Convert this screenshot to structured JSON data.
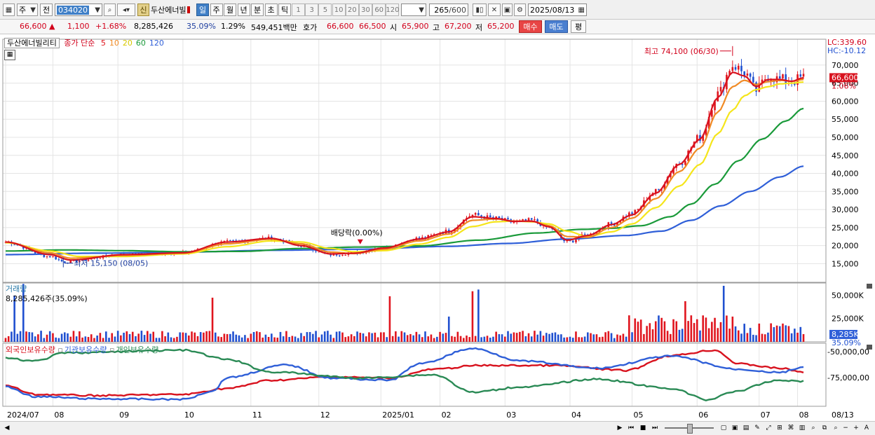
{
  "toolbar": {
    "period_label": "주",
    "prev_label": "전",
    "code_value": "034020",
    "stock_name": "두산에너빌",
    "new_badge": "신",
    "timeframes": [
      {
        "label": "일",
        "selected": true
      },
      {
        "label": "주",
        "selected": false
      },
      {
        "label": "월",
        "selected": false
      },
      {
        "label": "년",
        "selected": false
      },
      {
        "label": "분",
        "selected": false
      },
      {
        "label": "초",
        "selected": false
      },
      {
        "label": "틱",
        "selected": false
      }
    ],
    "intervals": [
      "1",
      "3",
      "5",
      "10",
      "20",
      "30",
      "60",
      "120"
    ],
    "count_value": "265",
    "count_total": "/600",
    "date_value": "2025/08/13"
  },
  "quote": {
    "price": "66,600",
    "arrow": "▲",
    "change": "1,100",
    "change_pct": "+1.68%",
    "volume": "8,285,426",
    "vol_ratio": "35.09%",
    "turnover": "1.29%",
    "amount": "549,451백만",
    "bid_label": "호가",
    "ask": "66,600",
    "bid": "66,500",
    "open_label": "시",
    "open": "65,900",
    "high_label": "고",
    "high": "67,200",
    "low_label": "저",
    "low": "65,200",
    "buy_label": "매수",
    "sell_label": "매도",
    "eval_label": "평"
  },
  "price_panel": {
    "name": "두산에너빌리티",
    "ma_title": "종가 단순",
    "ma_periods": [
      {
        "label": "5",
        "color": "#e0151e"
      },
      {
        "label": "10",
        "color": "#f08a24"
      },
      {
        "label": "20",
        "color": "#f0e01a"
      },
      {
        "label": "60",
        "color": "#1a9a3a"
      },
      {
        "label": "120",
        "color": "#2f5fd8"
      }
    ],
    "lc_label": "LC:339.60",
    "hc_label": "HC:-10.12",
    "current_tag": "66,600",
    "current_pct": "1.06%",
    "high_annotation": "최고 74,100 (06/30)",
    "low_annotation": "최저 15,150 (08/05)",
    "dividend_annotation": "배당락(0.00%)"
  },
  "volume_panel": {
    "title": "거래량",
    "value_text": "8,285,426주(35.09%)",
    "current_tag": "8,285K",
    "current_pct": "35.09%"
  },
  "holdings_panel": {
    "series": [
      {
        "label": "외국인보유수량",
        "color": "#d8121e"
      },
      {
        "label": "기관보유수량",
        "color": "#2f5fd8"
      },
      {
        "label": "개인보유수량",
        "color": "#2a8a55"
      }
    ]
  },
  "chart_data": [
    {
      "type": "line",
      "panel": "price",
      "y_ticks": [
        15000,
        20000,
        25000,
        30000,
        35000,
        40000,
        45000,
        50000,
        55000,
        60000,
        65000,
        70000
      ],
      "y_tick_labels": [
        "15,000",
        "20,000",
        "25,000",
        "30,000",
        "35,000",
        "40,000",
        "45,000",
        "50,000",
        "55,000",
        "60,000",
        "65,000",
        "70,000"
      ],
      "ylim": [
        11000,
        76000
      ],
      "x_labels": [
        "2024/07",
        "08",
        "09",
        "10",
        "11",
        "12",
        "2025/01",
        "02",
        "03",
        "04",
        "05",
        "06",
        "07",
        "08",
        "08/13"
      ],
      "close_anchors": [
        [
          0,
          21000
        ],
        [
          15,
          17000
        ],
        [
          20,
          15500
        ],
        [
          40,
          17500
        ],
        [
          60,
          18000
        ],
        [
          75,
          21000
        ],
        [
          90,
          22000
        ],
        [
          100,
          20000
        ],
        [
          110,
          17500
        ],
        [
          118,
          18000
        ],
        [
          128,
          19500
        ],
        [
          140,
          22000
        ],
        [
          150,
          24000
        ],
        [
          158,
          28500
        ],
        [
          166,
          27500
        ],
        [
          172,
          26500
        ],
        [
          178,
          27000
        ],
        [
          184,
          25000
        ],
        [
          190,
          21000
        ],
        [
          197,
          23000
        ],
        [
          205,
          26000
        ],
        [
          212,
          29000
        ],
        [
          220,
          35000
        ],
        [
          228,
          43000
        ],
        [
          235,
          50000
        ],
        [
          241,
          62000
        ],
        [
          246,
          70000
        ],
        [
          250,
          68000
        ],
        [
          254,
          63000
        ],
        [
          258,
          67000
        ],
        [
          262,
          66000
        ],
        [
          266,
          65500
        ],
        [
          270,
          66600
        ]
      ],
      "ma_anchors": {
        "ma5": [
          [
            0,
            21000
          ],
          [
            15,
            17500
          ],
          [
            22,
            16000
          ],
          [
            40,
            17500
          ],
          [
            60,
            18000
          ],
          [
            75,
            21000
          ],
          [
            90,
            22000
          ],
          [
            100,
            20000
          ],
          [
            110,
            17700
          ],
          [
            118,
            17900
          ],
          [
            128,
            19300
          ],
          [
            140,
            21800
          ],
          [
            150,
            23800
          ],
          [
            158,
            28000
          ],
          [
            166,
            27500
          ],
          [
            172,
            26700
          ],
          [
            178,
            26800
          ],
          [
            184,
            25200
          ],
          [
            190,
            21500
          ],
          [
            197,
            22800
          ],
          [
            205,
            25800
          ],
          [
            212,
            28500
          ],
          [
            220,
            34500
          ],
          [
            228,
            42500
          ],
          [
            235,
            49500
          ],
          [
            241,
            61000
          ],
          [
            246,
            68000
          ],
          [
            250,
            67000
          ],
          [
            254,
            64000
          ],
          [
            258,
            66000
          ],
          [
            262,
            66000
          ],
          [
            266,
            65500
          ],
          [
            270,
            66500
          ]
        ],
        "ma10": [
          [
            0,
            21000
          ],
          [
            15,
            18000
          ],
          [
            22,
            16500
          ],
          [
            40,
            17300
          ],
          [
            60,
            17900
          ],
          [
            75,
            20500
          ],
          [
            90,
            21800
          ],
          [
            100,
            20500
          ],
          [
            110,
            18200
          ],
          [
            118,
            17800
          ],
          [
            128,
            19000
          ],
          [
            140,
            21300
          ],
          [
            150,
            23200
          ],
          [
            158,
            27000
          ],
          [
            166,
            27400
          ],
          [
            172,
            26800
          ],
          [
            178,
            26700
          ],
          [
            184,
            25500
          ],
          [
            190,
            22500
          ],
          [
            197,
            22300
          ],
          [
            205,
            25000
          ],
          [
            212,
            27600
          ],
          [
            220,
            33000
          ],
          [
            228,
            40500
          ],
          [
            235,
            47000
          ],
          [
            241,
            57000
          ],
          [
            246,
            64000
          ],
          [
            250,
            65800
          ],
          [
            254,
            64600
          ],
          [
            258,
            65400
          ],
          [
            262,
            65800
          ],
          [
            266,
            65500
          ],
          [
            270,
            66000
          ]
        ],
        "ma20": [
          [
            0,
            20800
          ],
          [
            15,
            18500
          ],
          [
            25,
            17000
          ],
          [
            40,
            17000
          ],
          [
            60,
            17700
          ],
          [
            75,
            19700
          ],
          [
            90,
            21300
          ],
          [
            100,
            21000
          ],
          [
            110,
            19200
          ],
          [
            118,
            18300
          ],
          [
            128,
            18600
          ],
          [
            140,
            20400
          ],
          [
            150,
            22300
          ],
          [
            158,
            25300
          ],
          [
            166,
            26600
          ],
          [
            172,
            26800
          ],
          [
            178,
            26600
          ],
          [
            184,
            26000
          ],
          [
            190,
            24000
          ],
          [
            197,
            22500
          ],
          [
            205,
            23800
          ],
          [
            212,
            26000
          ],
          [
            220,
            30500
          ],
          [
            228,
            36500
          ],
          [
            235,
            42500
          ],
          [
            241,
            51000
          ],
          [
            246,
            57500
          ],
          [
            250,
            61500
          ],
          [
            254,
            63200
          ],
          [
            258,
            64000
          ],
          [
            262,
            64800
          ],
          [
            266,
            65000
          ],
          [
            270,
            65300
          ]
        ],
        "ma60": [
          [
            0,
            18500
          ],
          [
            20,
            18800
          ],
          [
            40,
            18600
          ],
          [
            60,
            18300
          ],
          [
            80,
            18400
          ],
          [
            100,
            19200
          ],
          [
            120,
            19600
          ],
          [
            140,
            19900
          ],
          [
            160,
            21500
          ],
          [
            180,
            23500
          ],
          [
            195,
            24500
          ],
          [
            205,
            24800
          ],
          [
            215,
            25500
          ],
          [
            225,
            28000
          ],
          [
            232,
            31500
          ],
          [
            240,
            37000
          ],
          [
            248,
            43500
          ],
          [
            256,
            49500
          ],
          [
            264,
            54500
          ],
          [
            270,
            58000
          ]
        ],
        "ma120": [
          [
            0,
            17500
          ],
          [
            30,
            17900
          ],
          [
            60,
            18200
          ],
          [
            90,
            18700
          ],
          [
            120,
            19000
          ],
          [
            150,
            19800
          ],
          [
            170,
            20600
          ],
          [
            190,
            21800
          ],
          [
            210,
            22800
          ],
          [
            222,
            24000
          ],
          [
            232,
            27000
          ],
          [
            242,
            31000
          ],
          [
            252,
            35000
          ],
          [
            262,
            39000
          ],
          [
            270,
            42000
          ]
        ]
      },
      "annotations": [
        {
          "text": "최고 74,100 (06/30)",
          "x_index": 246,
          "value": 74100
        },
        {
          "text": "최저 15,150 (08/05)",
          "x_index": 20,
          "value": 15150
        },
        {
          "text": "배당락(0.00%)",
          "x_index": 120,
          "value": 19000
        }
      ]
    },
    {
      "type": "bar",
      "panel": "volume",
      "y_tick_labels": [
        "25,000K",
        "50,000K"
      ],
      "y_ticks": [
        25000,
        50000
      ],
      "ylim": [
        0,
        60000
      ],
      "unit": "K shares",
      "current_value": 8285
    },
    {
      "type": "line",
      "panel": "holdings",
      "y_tick_labels": [
        "-50,000,00",
        "-75,000,00"
      ],
      "series": [
        {
          "name": "외국인보유수량",
          "anchors": [
            [
              0,
              0.7
            ],
            [
              10,
              0.86
            ],
            [
              30,
              0.88
            ],
            [
              60,
              0.86
            ],
            [
              75,
              0.75
            ],
            [
              90,
              0.6
            ],
            [
              110,
              0.54
            ],
            [
              130,
              0.56
            ],
            [
              145,
              0.4
            ],
            [
              160,
              0.33
            ],
            [
              185,
              0.33
            ],
            [
              210,
              0.42
            ],
            [
              225,
              0.15
            ],
            [
              240,
              0.05
            ],
            [
              248,
              0.3
            ],
            [
              262,
              0.38
            ],
            [
              270,
              0.45
            ]
          ]
        },
        {
          "name": "기관보유수량",
          "anchors": [
            [
              0,
              0.72
            ],
            [
              10,
              0.9
            ],
            [
              30,
              0.94
            ],
            [
              60,
              0.95
            ],
            [
              70,
              0.8
            ],
            [
              75,
              0.55
            ],
            [
              95,
              0.32
            ],
            [
              110,
              0.56
            ],
            [
              130,
              0.6
            ],
            [
              140,
              0.3
            ],
            [
              158,
              0.02
            ],
            [
              175,
              0.25
            ],
            [
              200,
              0.38
            ],
            [
              225,
              0.16
            ],
            [
              248,
              0.4
            ],
            [
              262,
              0.46
            ],
            [
              270,
              0.36
            ]
          ]
        },
        {
          "name": "개인보유수량",
          "anchors": [
            [
              0,
              0.2
            ],
            [
              10,
              0.25
            ],
            [
              20,
              0.1
            ],
            [
              60,
              0.05
            ],
            [
              75,
              0.22
            ],
            [
              90,
              0.45
            ],
            [
              120,
              0.56
            ],
            [
              145,
              0.5
            ],
            [
              158,
              0.82
            ],
            [
              175,
              0.72
            ],
            [
              200,
              0.58
            ],
            [
              225,
              0.75
            ],
            [
              238,
              0.96
            ],
            [
              245,
              0.82
            ],
            [
              262,
              0.6
            ],
            [
              270,
              0.62
            ]
          ]
        }
      ]
    }
  ]
}
